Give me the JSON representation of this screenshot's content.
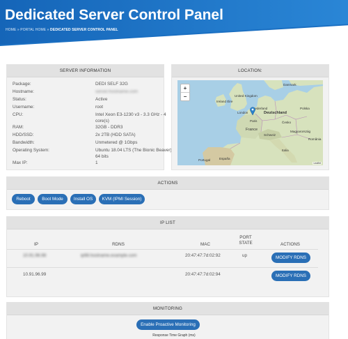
{
  "header": {
    "title": "Dedicated Server Control Panel",
    "breadcrumb": [
      "HOME",
      "PORTAL HOME",
      "DEDICATED SERVER CONTROL PANEL"
    ],
    "separator": "»",
    "colors": {
      "primary": "#1a6fc2",
      "button": "#2a6fb6"
    }
  },
  "server_info": {
    "title": "SERVER INFORMATION",
    "rows": [
      {
        "label": "Package:",
        "value": "DEDI SELF 32G"
      },
      {
        "label": "Hostname:",
        "value": "server.hostname.com",
        "redacted": true
      },
      {
        "label": "Status:",
        "value": "Active"
      },
      {
        "label": "Username:",
        "value": "root"
      },
      {
        "label": "CPU:",
        "value": "Intel Xeon E3-1230 v3 - 3.3 GHz - 4 core(s)"
      },
      {
        "label": "RAM:",
        "value": "32GB - DDR3"
      },
      {
        "label": "HDD/SSD:",
        "value": "2x 2TB (HDD SATA)"
      },
      {
        "label": "Bandwidth:",
        "value": "Unmetered @ 1Gbps"
      },
      {
        "label": "Operating System:",
        "value": "Ubuntu 18.04 LTS (The Bionic Beaver), 64 bits"
      },
      {
        "label": "Max IP:",
        "value": "1"
      }
    ]
  },
  "location": {
    "title": "LOCATION:",
    "zoom_in": "+",
    "zoom_out": "−",
    "attribution": "Leaflet",
    "labels": [
      "Danmark",
      "United Kingdom",
      "Ireland Éire",
      "Nederland",
      "Polska",
      "Deutschland",
      "London",
      "Paris",
      "France",
      "Magyarország",
      "România",
      "Schweiz",
      "Italia",
      "España",
      "Portugal",
      "Česko"
    ]
  },
  "actions": {
    "title": "ACTIONS",
    "buttons": [
      "Reboot",
      "Boot Mode",
      "Install OS",
      "KVM (IPMI Session)"
    ]
  },
  "ip_list": {
    "title": "IP LIST",
    "columns": [
      "IP",
      "RDNS",
      "MAC",
      "PORT STATE",
      "ACTIONS"
    ],
    "rows": [
      {
        "ip": "10.91.96.98",
        "ip_redacted": true,
        "rdns": "ip98.hostname.example.com",
        "rdns_redacted": true,
        "mac": "20:47:47:7d:02:92",
        "port_state": "up",
        "action": "MODIFY RDNS"
      },
      {
        "ip": "10.91.96.99",
        "ip_redacted": false,
        "rdns": "",
        "rdns_redacted": false,
        "mac": "20:47:47:7d:02:94",
        "port_state": "",
        "action": "MODIFY RDNS"
      }
    ]
  },
  "monitoring": {
    "title": "MONITORING",
    "button": "Enable Proactive Monitoring",
    "caption": "Response Time Graph (ms)"
  }
}
